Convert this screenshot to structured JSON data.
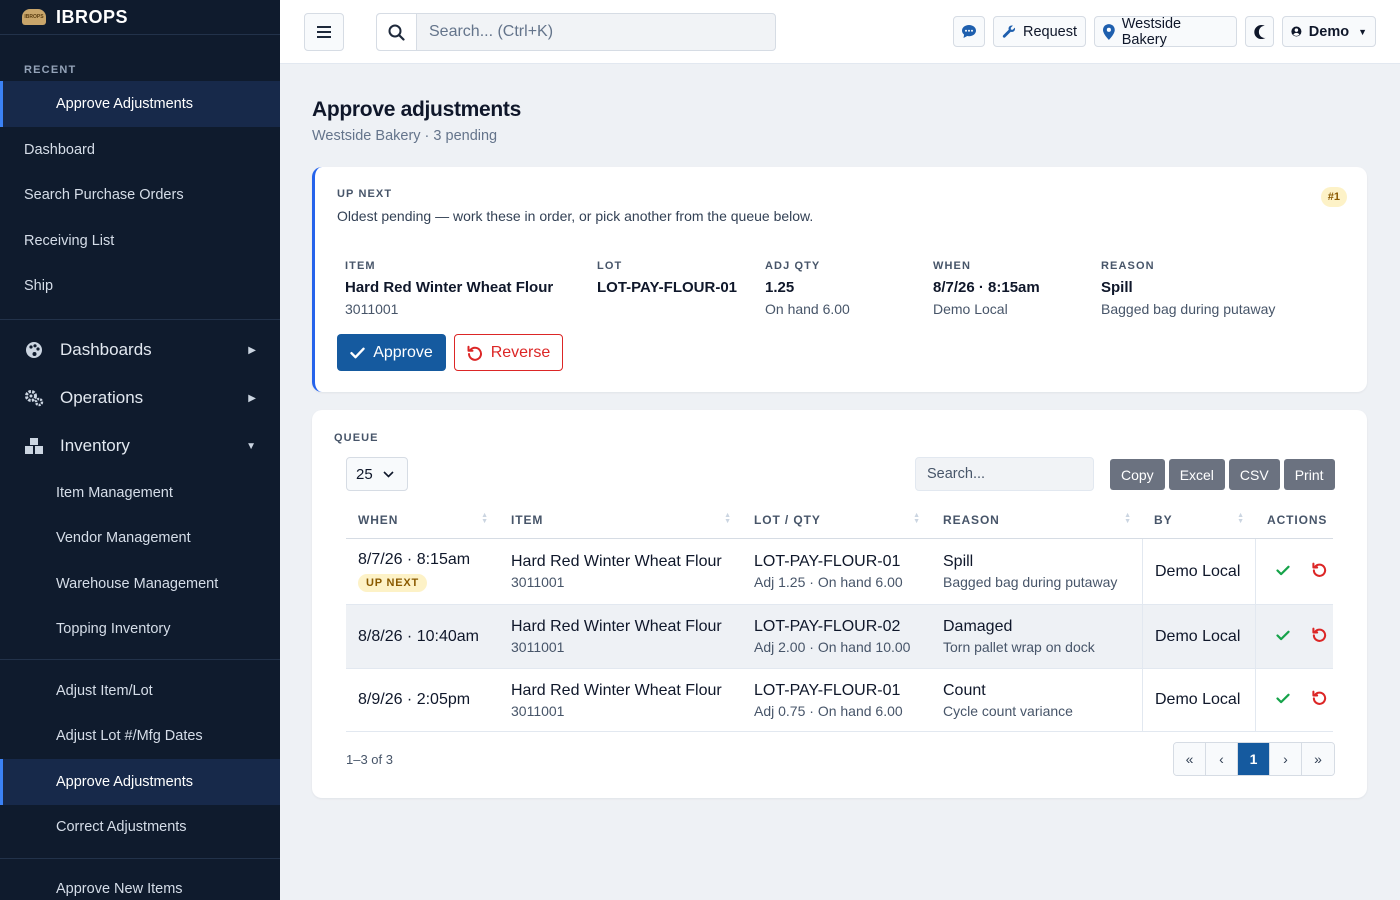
{
  "brand": {
    "name": "IBROPS",
    "logo_text": "IBROPS"
  },
  "sidebar": {
    "recent_label": "RECENT",
    "recent_items": [
      {
        "label": "Approve Adjustments"
      }
    ],
    "quick_items": [
      {
        "label": "Dashboard"
      },
      {
        "label": "Search Purchase Orders"
      },
      {
        "label": "Receiving List"
      },
      {
        "label": "Ship"
      }
    ],
    "groups": [
      {
        "label": "Dashboards",
        "icon": "palette-icon",
        "expanded": false
      },
      {
        "label": "Operations",
        "icon": "cogs-icon",
        "expanded": false
      },
      {
        "label": "Inventory",
        "icon": "boxes-icon",
        "expanded": true
      }
    ],
    "inventory_items": [
      {
        "label": "Item Management"
      },
      {
        "label": "Vendor Management"
      },
      {
        "label": "Warehouse Management"
      },
      {
        "label": "Topping Inventory"
      }
    ],
    "adjust_items": [
      {
        "label": "Adjust Item/Lot"
      },
      {
        "label": "Adjust Lot #/Mfg Dates"
      },
      {
        "label": "Approve Adjustments",
        "active": true
      },
      {
        "label": "Correct Adjustments"
      }
    ],
    "approve_items": [
      {
        "label": "Approve New Items"
      }
    ]
  },
  "topbar": {
    "search_placeholder": "Search... (Ctrl+K)",
    "request_label": "Request",
    "location_label": "Westside Bakery",
    "user_label": "Demo"
  },
  "page": {
    "title": "Approve adjustments",
    "subtitle": "Westside Bakery · 3 pending"
  },
  "up_next": {
    "label": "UP NEXT",
    "description": "Oldest pending — work these in order, or pick another from the queue below.",
    "badge": "#1",
    "fields": [
      {
        "label": "ITEM",
        "value": "Hard Red Winter Wheat Flour",
        "sub": "3011001"
      },
      {
        "label": "LOT",
        "value": "LOT-PAY-FLOUR-01",
        "sub": ""
      },
      {
        "label": "ADJ QTY",
        "value": "1.25",
        "sub": "On hand 6.00"
      },
      {
        "label": "WHEN",
        "value": "8/7/26 · 8:15am",
        "sub": "Demo Local"
      },
      {
        "label": "REASON",
        "value": "Spill",
        "sub": "Bagged bag during putaway"
      }
    ],
    "approve_label": "Approve",
    "reverse_label": "Reverse"
  },
  "queue": {
    "label": "QUEUE",
    "page_length": "25",
    "search_placeholder": "Search...",
    "export_buttons": [
      "Copy",
      "Excel",
      "CSV",
      "Print"
    ],
    "columns": [
      "WHEN",
      "ITEM",
      "LOT / QTY",
      "REASON",
      "BY",
      "ACTIONS"
    ],
    "upnext_pill": "UP NEXT",
    "rows": [
      {
        "when": "8/7/26 · 8:15am",
        "up_next": true,
        "item": "Hard Red Winter Wheat Flour",
        "item_code": "3011001",
        "lot": "LOT-PAY-FLOUR-01",
        "qty": "Adj 1.25 · On hand 6.00",
        "reason": "Spill",
        "reason_detail": "Bagged bag during putaway",
        "by": "Demo Local"
      },
      {
        "when": "8/8/26 · 10:40am",
        "up_next": false,
        "item": "Hard Red Winter Wheat Flour",
        "item_code": "3011001",
        "lot": "LOT-PAY-FLOUR-02",
        "qty": "Adj 2.00 · On hand 10.00",
        "reason": "Damaged",
        "reason_detail": "Torn pallet wrap on dock",
        "by": "Demo Local"
      },
      {
        "when": "8/9/26 · 2:05pm",
        "up_next": false,
        "item": "Hard Red Winter Wheat Flour",
        "item_code": "3011001",
        "lot": "LOT-PAY-FLOUR-01",
        "qty": "Adj 0.75 · On hand 6.00",
        "reason": "Count",
        "reason_detail": "Cycle count variance",
        "by": "Demo Local"
      }
    ],
    "info": "1–3 of 3",
    "pager": [
      "«",
      "‹",
      "1",
      "›",
      "»"
    ],
    "current_page": "1"
  },
  "colors": {
    "sidebar_bg": "#0f1b2d",
    "primary": "#155a9f",
    "danger": "#dc2626",
    "success": "#16a34a",
    "accent": "#2563eb"
  }
}
